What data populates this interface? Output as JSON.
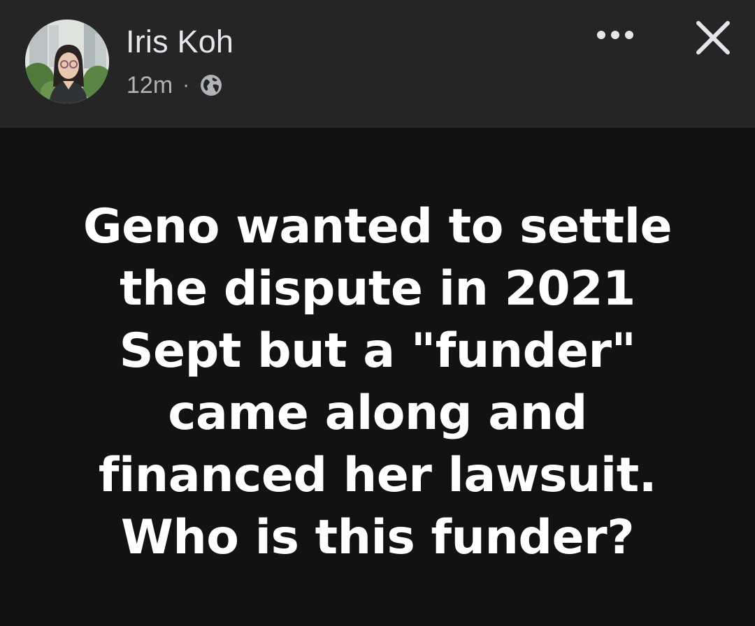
{
  "post_header": {
    "author_name": "Iris Koh",
    "timestamp": "12m",
    "separator": "·",
    "audience_icon": "globe-icon",
    "more_icon": "more-options-icon",
    "close_icon": "close-icon"
  },
  "post": {
    "text": "Geno wanted to settle\nthe dispute in 2021\nSept but a \"funder\"\ncame along and\nfinanced her lawsuit.\nWho is this funder?"
  },
  "colors": {
    "header_background": "#252525",
    "post_background": "#121212",
    "text_primary": "#e4e6eb",
    "text_secondary": "#b0b3b8",
    "post_text": "#ffffff"
  }
}
